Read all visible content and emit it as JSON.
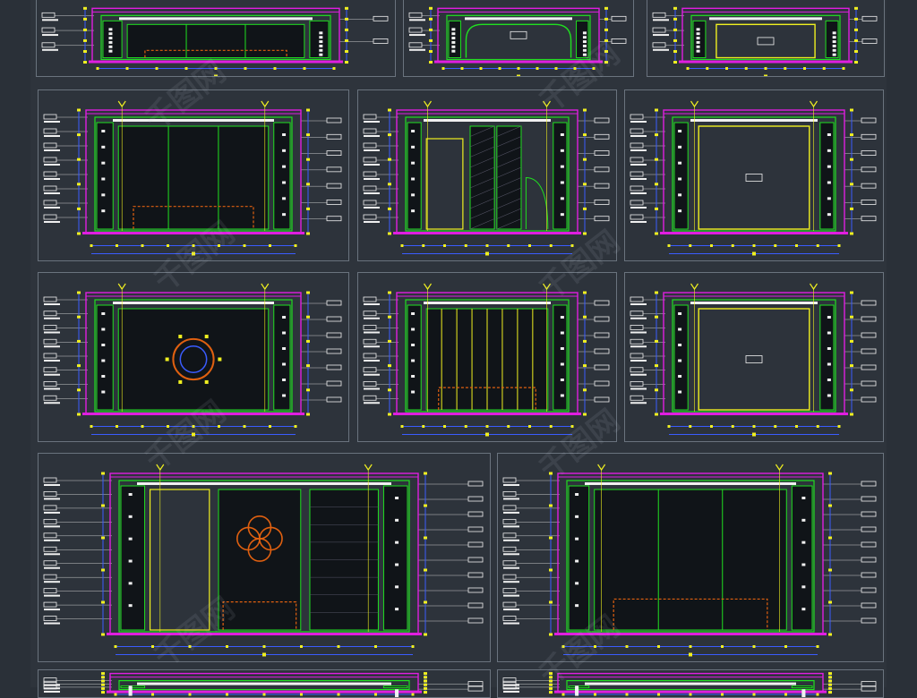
{
  "page": {
    "background": "#2a3038",
    "panel_border": "#6a737e"
  },
  "colors": {
    "frame": "#e01ee0",
    "wall": "#20e020",
    "blue": "#3a5cff",
    "yellow": "#f0f020",
    "cyan": "#20e0e0",
    "orange": "#e06010",
    "white": "#f0f0f0",
    "dark": "#101418"
  },
  "panels": [
    {
      "id": "p1",
      "variant": "headboard-dark"
    },
    {
      "id": "p2",
      "variant": "arched-door"
    },
    {
      "id": "p3",
      "variant": "center-box"
    },
    {
      "id": "p4",
      "variant": "wardrobe-bed"
    },
    {
      "id": "p5",
      "variant": "door-glass"
    },
    {
      "id": "p6",
      "variant": "center-box"
    },
    {
      "id": "p7",
      "variant": "medallion"
    },
    {
      "id": "p8",
      "variant": "striped-headboard"
    },
    {
      "id": "p9",
      "variant": "center-box"
    },
    {
      "id": "p10",
      "variant": "quatrefoil-wide"
    },
    {
      "id": "p11",
      "variant": "wardrobe-tall"
    },
    {
      "id": "p12",
      "variant": "partial"
    },
    {
      "id": "p13",
      "variant": "partial"
    }
  ]
}
